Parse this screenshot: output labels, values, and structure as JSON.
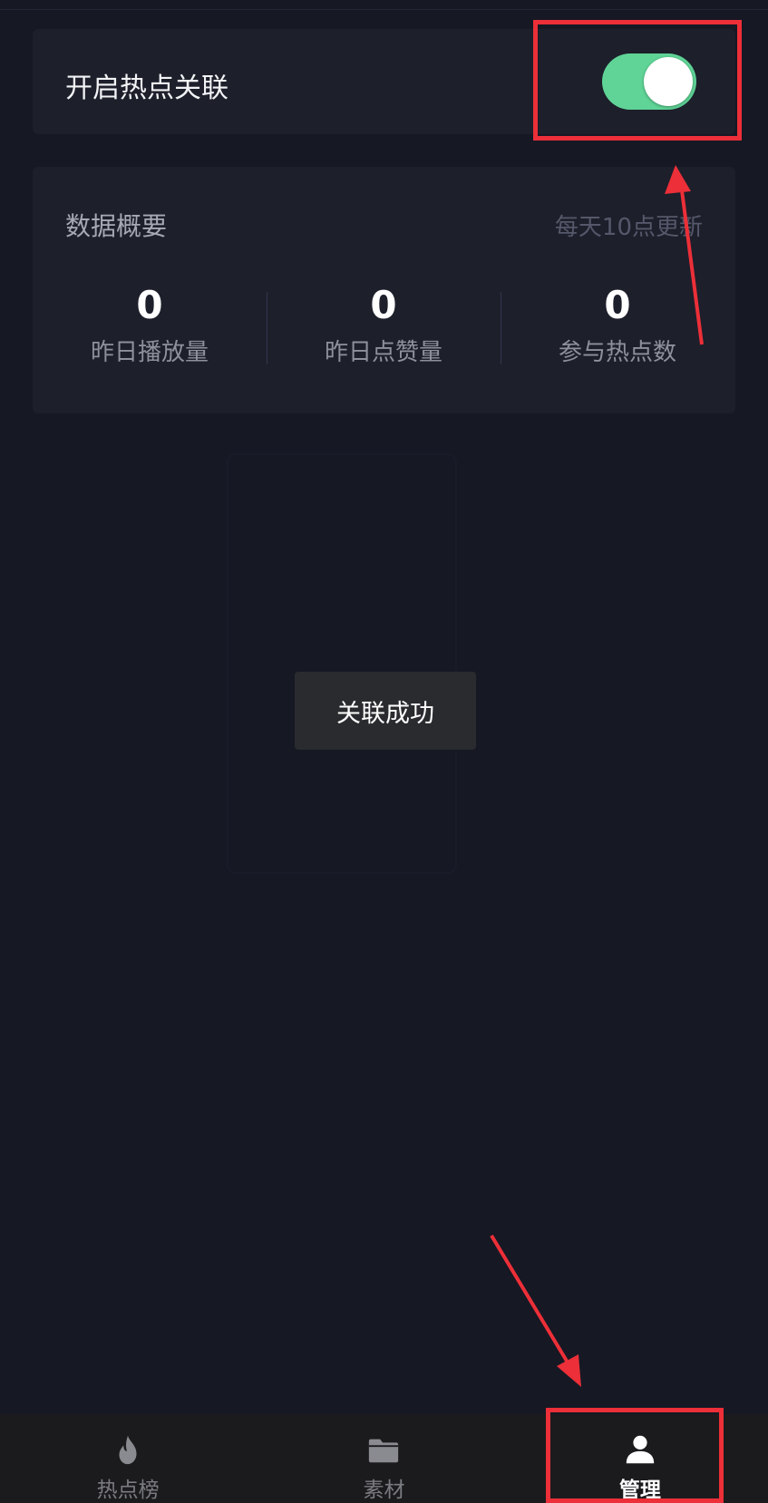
{
  "toggle": {
    "label": "开启热点关联",
    "state": "on",
    "on_color": "#5fd496"
  },
  "stats": {
    "title": "数据概要",
    "note": "每天10点更新",
    "items": [
      {
        "value": "0",
        "label": "昨日播放量"
      },
      {
        "value": "0",
        "label": "昨日点赞量"
      },
      {
        "value": "0",
        "label": "参与热点数"
      }
    ]
  },
  "toast": {
    "message": "关联成功"
  },
  "tabbar": {
    "tabs": [
      {
        "label": "热点榜",
        "icon": "flame-icon",
        "active": false
      },
      {
        "label": "素材",
        "icon": "folder-icon",
        "active": false
      },
      {
        "label": "管理",
        "icon": "user-icon",
        "active": true
      }
    ]
  },
  "annotation_color": "#ec2f38"
}
